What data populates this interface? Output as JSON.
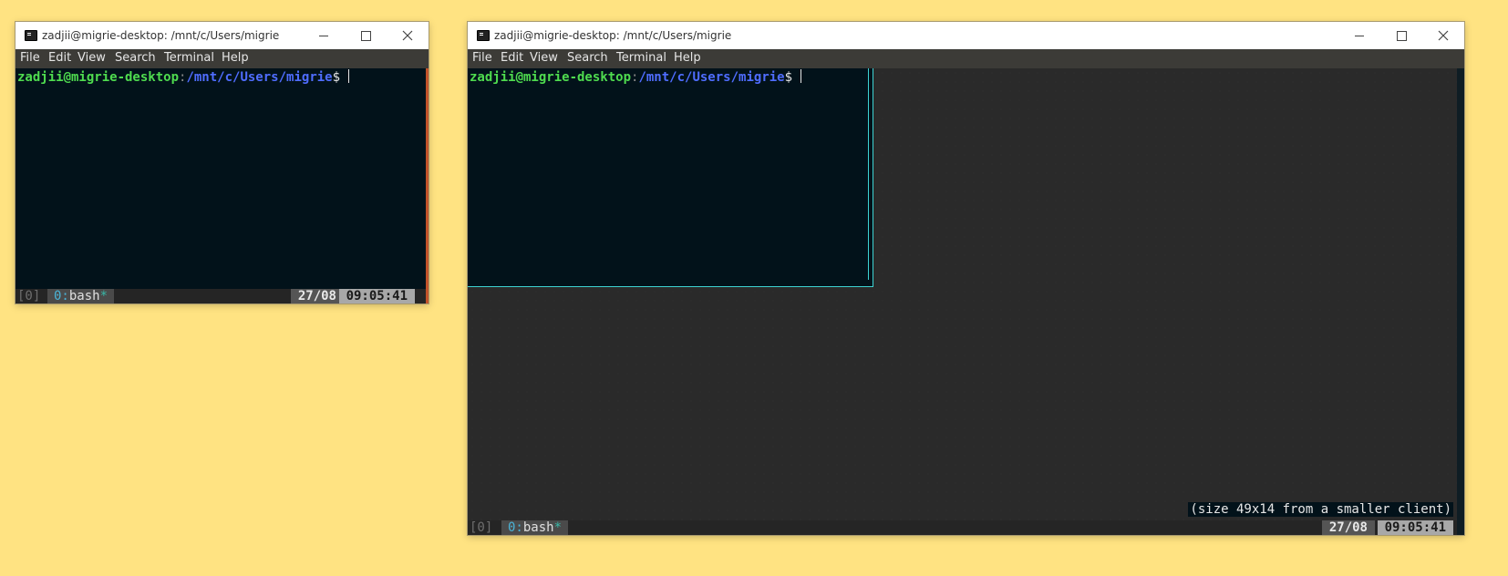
{
  "window_small": {
    "title": "zadjii@migrie-desktop: /mnt/c/Users/migrie",
    "menu": [
      "File",
      "Edit",
      "View",
      "Search",
      "Terminal",
      "Help"
    ],
    "prompt": {
      "user_host": "zadjii@migrie-desktop",
      "colon": ":",
      "path": "/mnt/c/Users/migrie",
      "dollar": "$"
    },
    "status": {
      "session": "[0]",
      "window_index": "0:",
      "window_name": "bash",
      "window_flag": "*",
      "date": "27/08",
      "time": "09:05:41"
    }
  },
  "window_large": {
    "title": "zadjii@migrie-desktop: /mnt/c/Users/migrie",
    "menu": [
      "File",
      "Edit",
      "View",
      "Search",
      "Terminal",
      "Help"
    ],
    "prompt": {
      "user_host": "zadjii@migrie-desktop",
      "colon": ":",
      "path": "/mnt/c/Users/migrie",
      "dollar": "$"
    },
    "size_message": "(size 49x14 from a smaller client)",
    "status": {
      "session": "[0]",
      "window_index": "0:",
      "window_name": "bash",
      "window_flag": "*",
      "date": "27/08",
      "time": "09:05:41"
    }
  },
  "colors": {
    "desktop": "#ffe382",
    "terminal_bg": "#02121a",
    "accent_cyan": "#3dd3d3",
    "accent_orange": "#c2532a"
  }
}
